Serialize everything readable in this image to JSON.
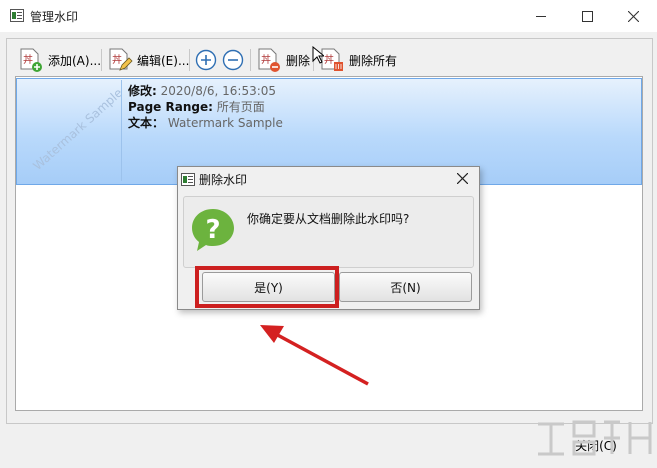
{
  "window": {
    "title": "管理水印",
    "minimize_glyph": "—",
    "maximize_glyph": "☐",
    "close_glyph": "✕"
  },
  "toolbar": {
    "add_label": "添加(A)...",
    "edit_label": "编辑(E)...",
    "delete_label": "删除",
    "delete_all_label": "删除所有",
    "icons": [
      "add-document-icon",
      "edit-document-icon",
      "move-up-plus-icon",
      "move-down-minus-icon",
      "delete-document-icon",
      "delete-all-documents-icon"
    ]
  },
  "watermark_item": {
    "thumbnail_text": "Watermark Sample",
    "modified_label": "修改:",
    "modified_value": "2020/8/6, 16:53:05",
    "page_range_label": "Page Range:",
    "page_range_value": "所有页面",
    "text_label": "文本：",
    "text_value": "Watermark Sample"
  },
  "dialog": {
    "title": "删除水印",
    "message": "你确定要从文档删除此水印吗?",
    "yes_label": "是(Y)",
    "no_label": "否(N)",
    "close_glyph": "✕"
  },
  "footer": {
    "close_label": "关闭(C)"
  },
  "colors": {
    "selection_top": "#e6f1fd",
    "selection_bottom": "#a6cdf8",
    "highlight_red": "#cc1f1f",
    "question_green": "#6cb33e",
    "arrow_red": "#d42121"
  }
}
